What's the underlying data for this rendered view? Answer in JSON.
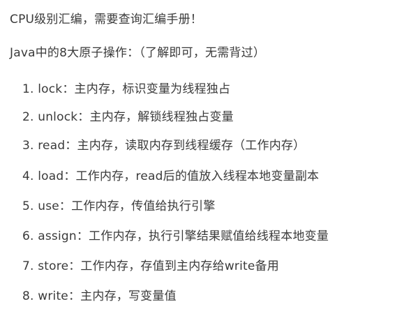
{
  "heading": "CPU级别汇编，需要查询汇编手册！",
  "intro": "Java中的8大原子操作：（了解即可，无需背过）",
  "operations": [
    "1. lock：主内存，标识变量为线程独占",
    "2. unlock：主内存，解锁线程独占变量",
    "3. read：主内存，读取内存到线程缓存（工作内存）",
    "4. load：工作内存，read后的值放入线程本地变量副本",
    "5. use：工作内存，传值给执行引擎",
    "6. assign：工作内存，执行引擎结果赋值给线程本地变量",
    "7. store：工作内存，存值到主内存给write备用",
    "8. write：主内存，写变量值"
  ]
}
